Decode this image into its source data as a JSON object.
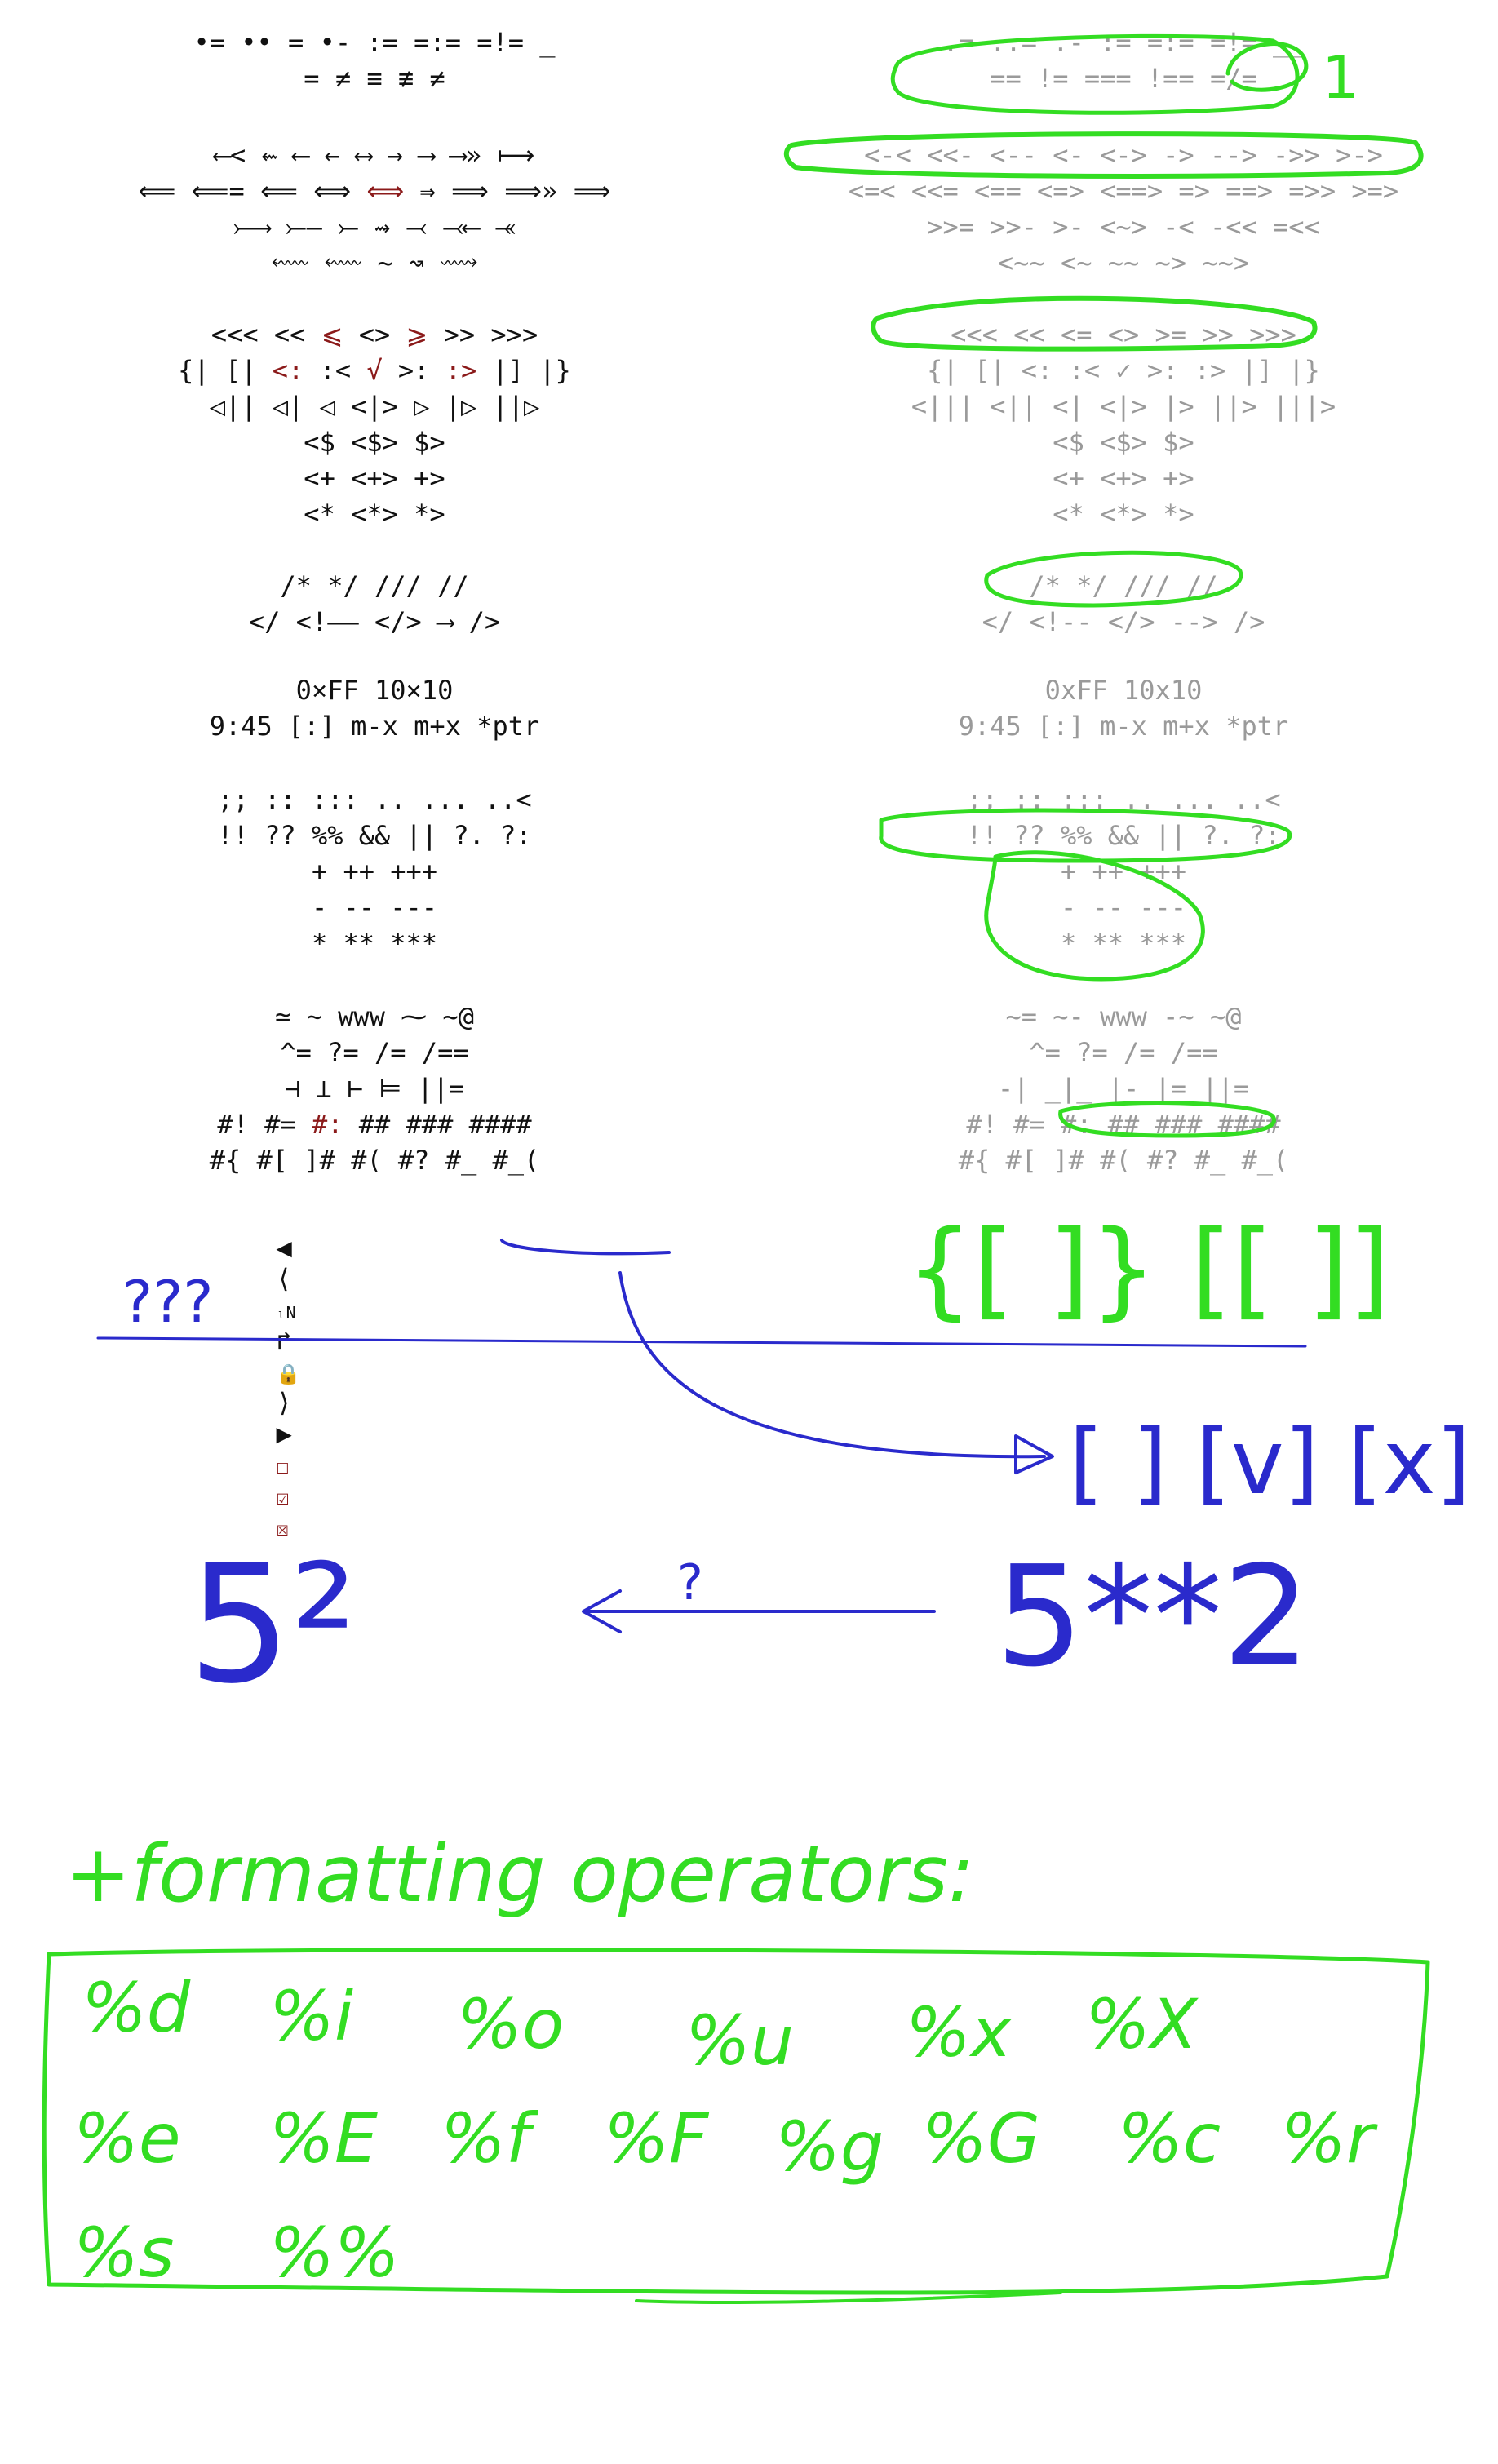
{
  "left_column": {
    "rows": [
      [
        "•= •• = •- := =:= =!= _"
      ],
      [
        "= ≠ ≡ ≢ ≠"
      ],
      [
        "⟵< ⇜ ⟵ ← ⟷ → ⟶ ⟶» ⟼"
      ],
      [
        "⟸ ⟸= ⟸ ⟺ ",
        "⟺",
        " ⇒ ⟹ ⟹» ⟹"
      ],
      [
        "⤚⟶ ⤚— ⤚ ⇝ ⤙ ⤙⟵ ⤛"
      ],
      [
        "⬳ ⬳ ~ ↝ ⟿"
      ],
      [
        "<<< << ",
        "⩽",
        " <> ",
        "⩾",
        " >> >>>"
      ],
      [
        "",
        "{| [|",
        " <: ",
        ":<",
        " √ ",
        ">:",
        " :> ",
        "|] |}"
      ],
      [
        "◁|| ◁| ◁ <|> ▷ |▷ ||▷"
      ],
      [
        "<$ <$> $>"
      ],
      [
        "<+ <+> +>"
      ],
      [
        "<* <*> *>"
      ],
      [
        "/* */ /// //"
      ],
      [
        "</ <!—— </> ⟶ />"
      ],
      [
        "0×FF 10×10"
      ],
      [
        "9:45 [:] m-x m+x *ptr"
      ],
      [
        ";; :: ::: .. ... ..<"
      ],
      [
        "!! ?? %% && || ?. ?:"
      ],
      [
        "+ ++ +++"
      ],
      [
        "- -- ---"
      ],
      [
        "* ** ***"
      ],
      [
        "≃ ∼ www ⁓ ~@"
      ],
      [
        "^= ?= /= /=="
      ],
      [
        "⊣ ⊥ ⊢ ⊨ ||="
      ],
      [
        "#! #= ",
        "#:",
        " ## ### ####"
      ],
      [
        "#{ #[ ]# #( #? #_ #_("
      ]
    ],
    "ui_glyphs": [
      "◀",
      "⟨",
      "ₗN",
      "↱",
      "🔒",
      "⟩",
      "▶"
    ],
    "checkboxes": [
      "☐",
      "☑",
      "☒"
    ]
  },
  "right_column": {
    "rows": [
      ".= ..= .- := =:= =!= __",
      "== != === !== =/=",
      "<-< <<- <-- <- <-> -> --> ->> >->",
      "<=< <<= <== <=> <==> => ==> =>> >=>",
      ">>= >>- >- <~> -< -<< =<<",
      "<~~ <~ ~~ ~> ~~>",
      "<<< << <= <> >= >> >>>",
      "{| [| <: :< ✓ >: :> |] |}",
      "<||| <|| <| <|> |> ||> |||>",
      "<$ <$> $>",
      "<+ <+> +>",
      "<* <*> *>",
      "/* */ /// //",
      "</ <!-- </> --> />",
      "0xFF 10x10",
      "9:45 [:] m-x m+x *ptr",
      ";; :: ::: .. ... ..<",
      "!! ?? %% && || ?. ?:",
      "+ ++ +++",
      "- -- ---",
      "* ** ***",
      "~= ~- www -~ ~@",
      "^= ?= /= /==",
      "-| _|_ |- |= ||=",
      "#! #= #: ## ### ####",
      "#{ #[ ]# #( #? #_ #_("
    ]
  },
  "annotations": {
    "number_one": "1",
    "question": "???",
    "brackets": "{[ ]} [[ ]]",
    "checkbox_text": "[ ] [v] [x]",
    "power": "5²",
    "power_arrow_label": "?",
    "power_op": "5**2",
    "formatting_title": "+formatting operators:",
    "formatting_rows": [
      [
        "%d",
        "%i",
        "%o",
        "%u",
        "%x",
        "%X"
      ],
      [
        "%e",
        "%E",
        "%f",
        "%F",
        "%g",
        "%G",
        "%c",
        "%r"
      ],
      [
        "%s",
        "%%"
      ]
    ]
  },
  "colors": {
    "green_ink": "#33dd22",
    "blue_ink": "#2a2acc",
    "red_text": "#8b1a1a",
    "grey_text": "#9a9a9a"
  }
}
